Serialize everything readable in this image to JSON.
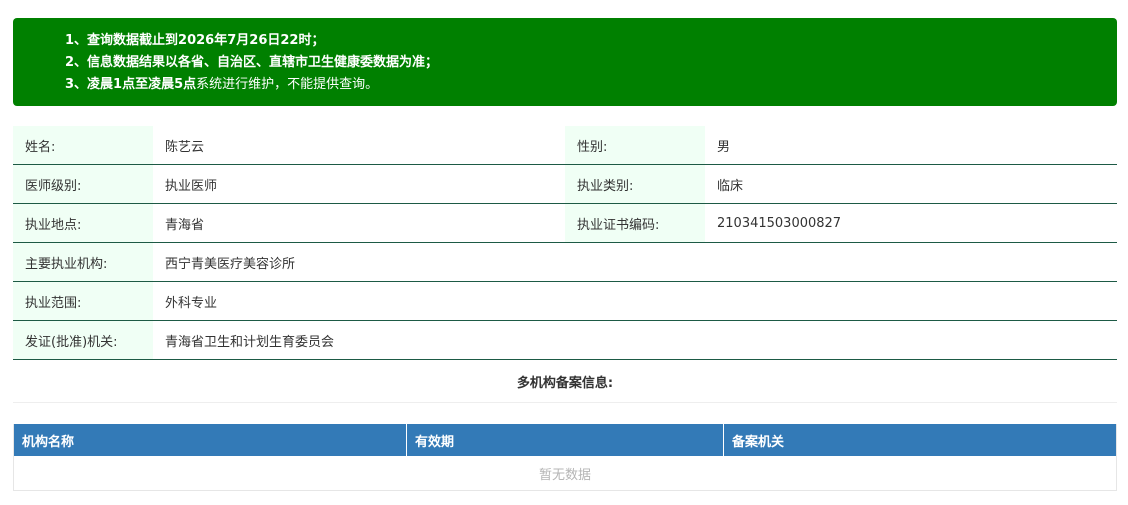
{
  "notice": {
    "line1": "1、查询数据截止到2026年7月26日22时；",
    "line2": "2、信息数据结果以各省、自治区、直辖市卫生健康委数据为准；",
    "line3_bold": "3、凌晨1点至凌晨5点",
    "line3_rest": "系统进行维护，不能提供查询。"
  },
  "info": {
    "name_label": "姓名:",
    "name_value": "陈艺云",
    "gender_label": "性别:",
    "gender_value": "男",
    "level_label": "医师级别:",
    "level_value": "执业医师",
    "category_label": "执业类别:",
    "category_value": "临床",
    "location_label": "执业地点:",
    "location_value": "青海省",
    "cert_label": "执业证书编码:",
    "cert_value": "210341503000827",
    "institution_label": "主要执业机构:",
    "institution_value": "西宁青美医疗美容诊所",
    "scope_label": "执业范围:",
    "scope_value": "外科专业",
    "issuer_label": "发证(批准)机关:",
    "issuer_value": "青海省卫生和计划生育委员会"
  },
  "multi": {
    "title": "多机构备案信息:",
    "columns": [
      "机构名称",
      "有效期",
      "备案机关"
    ],
    "empty_text": "暂无数据"
  },
  "colors": {
    "notice_bg": "#008000",
    "label_bg": "#f0fff5",
    "row_border": "#1d5a45",
    "table_header_bg": "#337ab7"
  }
}
